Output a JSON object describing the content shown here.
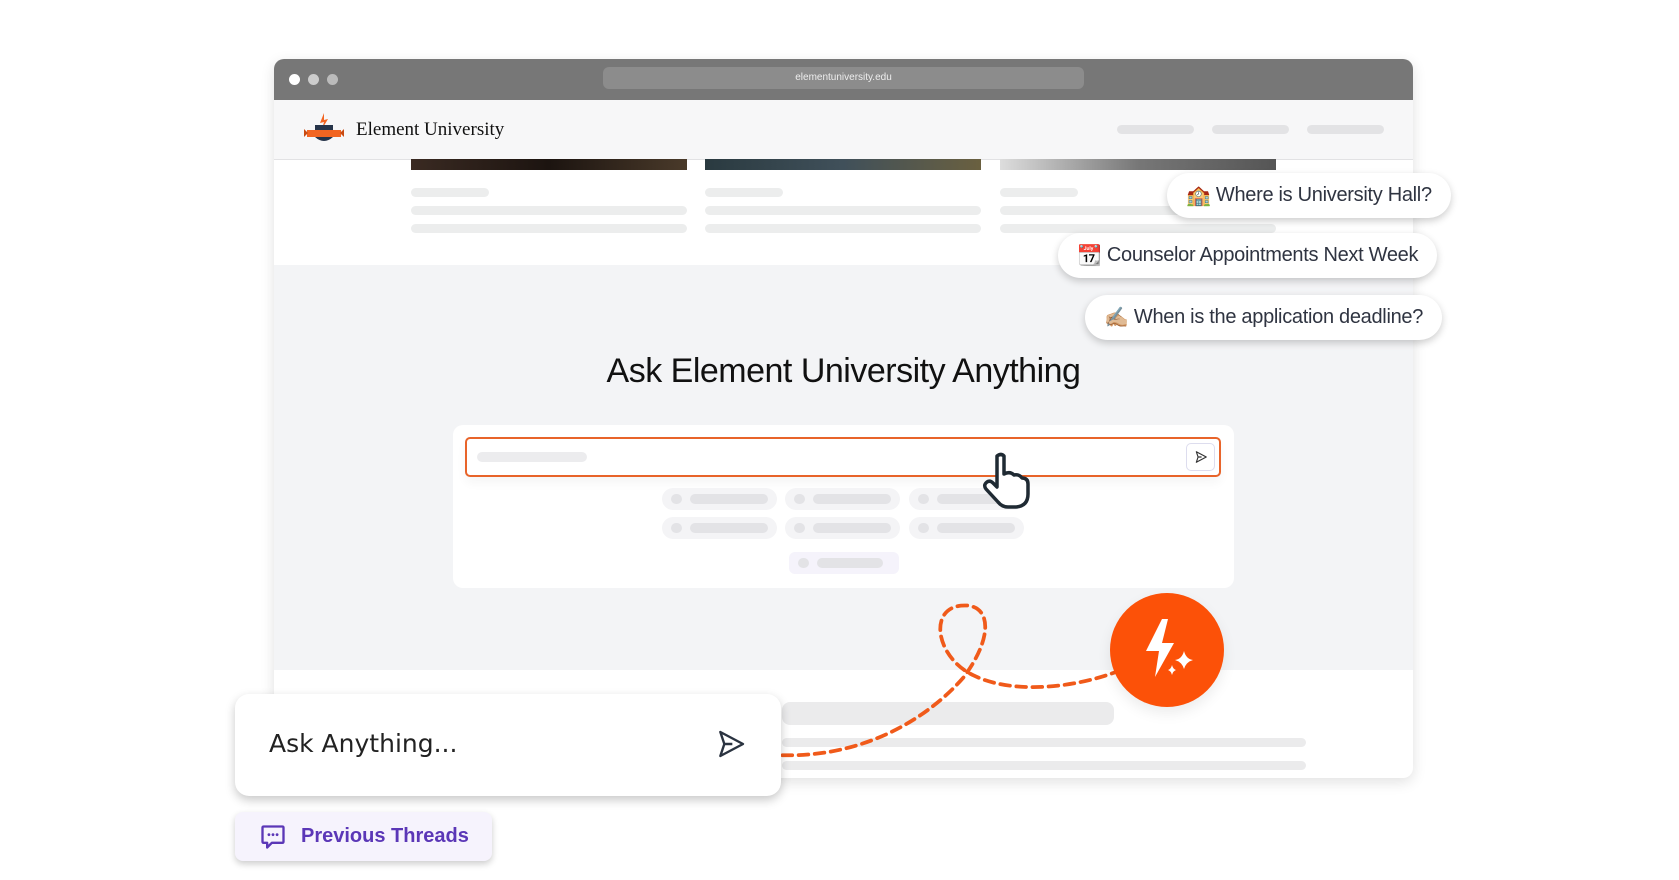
{
  "browser": {
    "url": "elementuniversity.edu"
  },
  "site": {
    "name": "Element University",
    "logo_text": "UNIVERSITY"
  },
  "main": {
    "title": "Ask Element University Anything"
  },
  "suggestions": [
    {
      "emoji": "🏫",
      "label": "Where is University Hall?"
    },
    {
      "emoji": "📆",
      "label": "Counselor Appointments Next Week"
    },
    {
      "emoji": "✍🏼",
      "label": "When is the application deadline?"
    }
  ],
  "widget": {
    "placeholder": "Ask Anything...",
    "previous_threads": "Previous Threads"
  },
  "colors": {
    "accent": "#fc5108",
    "purple": "#5b37b7"
  }
}
